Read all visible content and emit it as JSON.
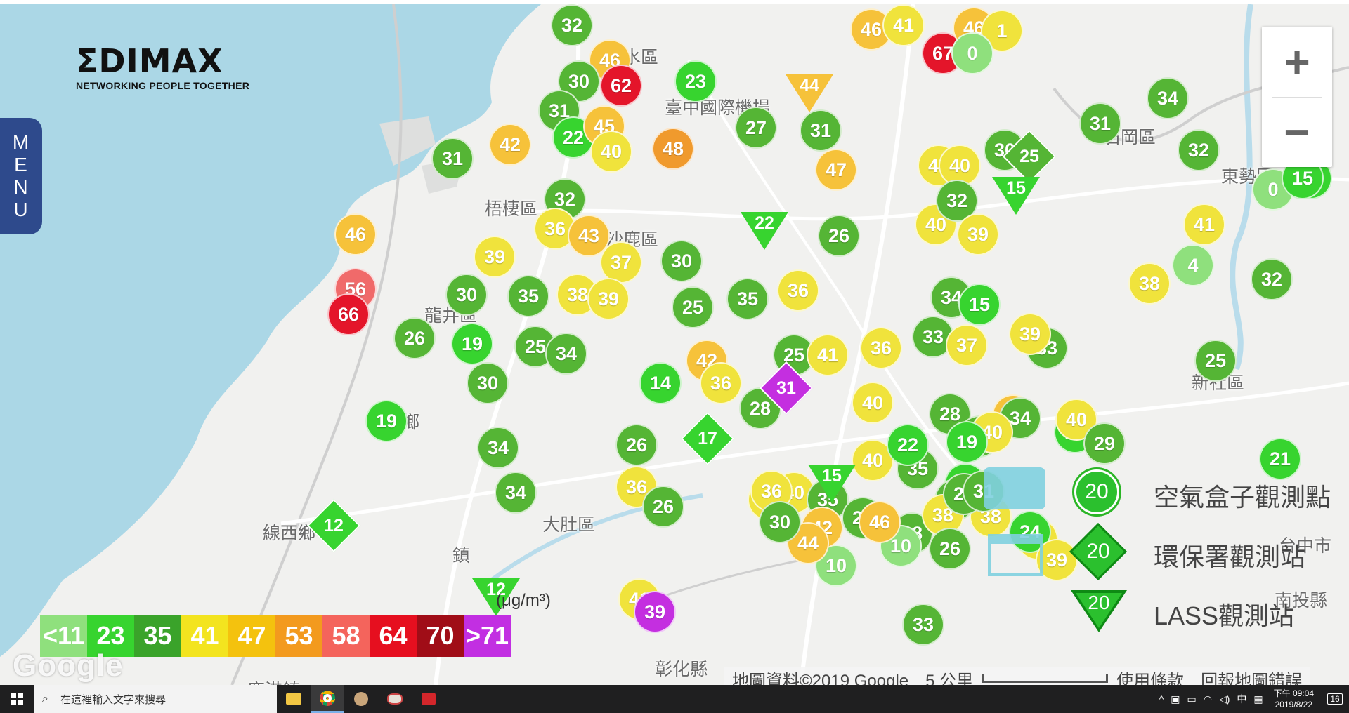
{
  "logo": {
    "brand": "ΣDIMAX",
    "tagline": "NETWORKING PEOPLE TOGETHER"
  },
  "menu": {
    "letters": [
      "M",
      "E",
      "N",
      "U"
    ]
  },
  "zoom": {
    "in_label": "+",
    "out_label": "−"
  },
  "places": [
    {
      "id": "qingshui",
      "label": "清水區"
    },
    {
      "id": "airport",
      "label": "臺中國際機場"
    },
    {
      "id": "wuqi",
      "label": "梧棲區"
    },
    {
      "id": "shalu",
      "label": "沙鹿區"
    },
    {
      "id": "longjing",
      "label": "龍井區"
    },
    {
      "id": "shengang",
      "label": "伸港鄉"
    },
    {
      "id": "xianxi",
      "label": "線西鄉"
    },
    {
      "id": "dadu",
      "label": "大肚區"
    },
    {
      "id": "shigang",
      "label": "石岡區"
    },
    {
      "id": "dongshi",
      "label": "東勢區"
    },
    {
      "id": "xinshe",
      "label": "新社區"
    },
    {
      "id": "taichung",
      "label": "台中市"
    },
    {
      "id": "nantou",
      "label": "南投縣"
    },
    {
      "id": "changhua",
      "label": "彰化縣"
    },
    {
      "id": "lugang",
      "label": "鹿港鎮"
    },
    {
      "id": "hemei",
      "label": "鎮"
    }
  ],
  "colors": {
    "c11": "#8fe07d",
    "c23": "#37d42f",
    "c35": "#55b535",
    "c41": "#f0e33c",
    "c47": "#f6c23a",
    "c53": "#f09a2d",
    "c58": "#f06a6a",
    "c64": "#e4152a",
    "c70": "#a0101e",
    "c71": "#c42fe0"
  },
  "legend": {
    "unit": "(μg/m³)",
    "scale": [
      {
        "label": "<11",
        "color": "#8fe07d"
      },
      {
        "label": "23",
        "color": "#37d42f"
      },
      {
        "label": "35",
        "color": "#3aa32a"
      },
      {
        "label": "41",
        "color": "#f3e41f"
      },
      {
        "label": "47",
        "color": "#f4c20e"
      },
      {
        "label": "53",
        "color": "#f39a1e"
      },
      {
        "label": "58",
        "color": "#f4645c"
      },
      {
        "label": "64",
        "color": "#e60f1f"
      },
      {
        "label": "70",
        "color": "#a00d17"
      },
      {
        "label": ">71",
        "color": "#c22fe2"
      }
    ],
    "types": [
      {
        "icon": "circle",
        "value": "20",
        "label": "空氣盒子觀測點"
      },
      {
        "icon": "diamond",
        "value": "20",
        "label": "環保署觀測站"
      },
      {
        "icon": "triangle",
        "value": "20",
        "label": "LASS觀測站"
      }
    ]
  },
  "attribution": {
    "google": "Google",
    "map_data": "地圖資料©2019 Google",
    "scale": "5 公里",
    "terms": "使用條款",
    "report": "回報地圖錯誤"
  },
  "markers": [
    {
      "v": "32",
      "c": "c35"
    },
    {
      "v": "46",
      "c": "c47"
    },
    {
      "v": "41",
      "c": "c41"
    },
    {
      "v": "67",
      "c": "c64"
    },
    {
      "v": "46",
      "c": "c47"
    },
    {
      "v": "1",
      "c": "c41"
    },
    {
      "v": "0",
      "c": "c11"
    },
    {
      "v": "46",
      "c": "c47"
    },
    {
      "v": "30",
      "c": "c35"
    },
    {
      "v": "62",
      "c": "c64"
    },
    {
      "v": "23",
      "c": "c23"
    },
    {
      "v": "34",
      "c": "c35"
    },
    {
      "v": "42",
      "c": "c47"
    },
    {
      "v": "31",
      "c": "c35"
    },
    {
      "v": "22",
      "c": "c23"
    },
    {
      "v": "45",
      "c": "c47"
    },
    {
      "v": "40",
      "c": "c41"
    },
    {
      "v": "48",
      "c": "c53"
    },
    {
      "v": "27",
      "c": "c35"
    },
    {
      "v": "31",
      "c": "c35"
    },
    {
      "v": "31",
      "c": "c35"
    },
    {
      "v": "32",
      "c": "c35"
    },
    {
      "v": "31",
      "c": "c35"
    },
    {
      "v": "47",
      "c": "c47"
    },
    {
      "v": "41",
      "c": "c41"
    },
    {
      "v": "40",
      "c": "c41"
    },
    {
      "v": "30",
      "c": "c35"
    },
    {
      "v": "15",
      "c": "c23"
    },
    {
      "v": "0",
      "c": "c11"
    },
    {
      "v": "32",
      "c": "c35"
    },
    {
      "v": "36",
      "c": "c41"
    },
    {
      "v": "43",
      "c": "c47"
    },
    {
      "v": "26",
      "c": "c35"
    },
    {
      "v": "40",
      "c": "c41"
    },
    {
      "v": "32",
      "c": "c35"
    },
    {
      "v": "39",
      "c": "c41"
    },
    {
      "v": "41",
      "c": "c41"
    },
    {
      "v": "46",
      "c": "c47"
    },
    {
      "v": "39",
      "c": "c41"
    },
    {
      "v": "15",
      "c": "c23"
    },
    {
      "v": "37",
      "c": "c41"
    },
    {
      "v": "30",
      "c": "c35"
    },
    {
      "v": "36",
      "c": "c41"
    },
    {
      "v": "4",
      "c": "c11"
    },
    {
      "v": "38",
      "c": "c41"
    },
    {
      "v": "32",
      "c": "c35"
    },
    {
      "v": "56",
      "c": "c58"
    },
    {
      "v": "66",
      "c": "c64"
    },
    {
      "v": "30",
      "c": "c35"
    },
    {
      "v": "35",
      "c": "c35"
    },
    {
      "v": "38",
      "c": "c41"
    },
    {
      "v": "39",
      "c": "c41"
    },
    {
      "v": "25",
      "c": "c35"
    },
    {
      "v": "35",
      "c": "c35"
    },
    {
      "v": "34",
      "c": "c35"
    },
    {
      "v": "15",
      "c": "c23"
    },
    {
      "v": "26",
      "c": "c35"
    },
    {
      "v": "19",
      "c": "c23"
    },
    {
      "v": "25",
      "c": "c35"
    },
    {
      "v": "34",
      "c": "c35"
    },
    {
      "v": "42",
      "c": "c47"
    },
    {
      "v": "25",
      "c": "c35"
    },
    {
      "v": "41",
      "c": "c41"
    },
    {
      "v": "36",
      "c": "c41"
    },
    {
      "v": "33",
      "c": "c35"
    },
    {
      "v": "37",
      "c": "c41"
    },
    {
      "v": "33",
      "c": "c35"
    },
    {
      "v": "39",
      "c": "c41"
    },
    {
      "v": "25",
      "c": "c35"
    },
    {
      "v": "30",
      "c": "c35"
    },
    {
      "v": "14",
      "c": "c23"
    },
    {
      "v": "36",
      "c": "c41"
    },
    {
      "v": "28",
      "c": "c35"
    },
    {
      "v": "40",
      "c": "c41"
    },
    {
      "v": "28",
      "c": "c35"
    },
    {
      "v": "43",
      "c": "c47"
    },
    {
      "v": "34",
      "c": "c35"
    },
    {
      "v": "12",
      "c": "c23"
    },
    {
      "v": "40",
      "c": "c41"
    },
    {
      "v": "19",
      "c": "c23"
    },
    {
      "v": "33",
      "c": "c35"
    },
    {
      "v": "40",
      "c": "c41"
    },
    {
      "v": "40",
      "c": "c41"
    },
    {
      "v": "35",
      "c": "c35"
    },
    {
      "v": "19",
      "c": "c23"
    },
    {
      "v": "23",
      "c": "c23"
    },
    {
      "v": "22",
      "c": "c23"
    },
    {
      "v": "29",
      "c": "c35"
    },
    {
      "v": "21",
      "c": "c23"
    },
    {
      "v": "34",
      "c": "c35"
    },
    {
      "v": "26",
      "c": "c35"
    },
    {
      "v": "36",
      "c": "c41"
    },
    {
      "v": "26",
      "c": "c35"
    },
    {
      "v": "36",
      "c": "c41"
    },
    {
      "v": "40",
      "c": "c41"
    },
    {
      "v": "35",
      "c": "c35"
    },
    {
      "v": "33",
      "c": "c35"
    },
    {
      "v": "38",
      "c": "c41"
    },
    {
      "v": "36",
      "c": "c41"
    },
    {
      "v": "25",
      "c": "c35"
    },
    {
      "v": "10",
      "c": "c11"
    },
    {
      "v": "28",
      "c": "c35"
    },
    {
      "v": "10",
      "c": "c11"
    },
    {
      "v": "41",
      "c": "c41"
    },
    {
      "v": "39",
      "c": "c71"
    },
    {
      "v": "33",
      "c": "c35"
    },
    {
      "v": "42",
      "c": "c47"
    },
    {
      "v": "38",
      "c": "c41"
    },
    {
      "v": "26",
      "c": "c35"
    },
    {
      "v": "39",
      "c": "c41"
    },
    {
      "v": "34",
      "c": "c35"
    },
    {
      "v": "46",
      "c": "c47"
    },
    {
      "v": "44",
      "c": "c47"
    },
    {
      "v": "30",
      "c": "c35"
    },
    {
      "v": "24",
      "c": "c23"
    },
    {
      "v": "28",
      "c": "c35"
    },
    {
      "v": "31",
      "c": "c35"
    },
    {
      "v": "39",
      "c": "c41"
    }
  ],
  "special_markers": [
    {
      "shape": "triangle",
      "v": "44",
      "c": "c47"
    },
    {
      "shape": "triangle",
      "v": "22",
      "c": "c23"
    },
    {
      "shape": "diamond",
      "v": "25",
      "c": "c35"
    },
    {
      "shape": "triangle",
      "v": "15",
      "c": "c23"
    },
    {
      "shape": "diamond",
      "v": "17",
      "c": "c23"
    },
    {
      "shape": "triangle",
      "v": "15",
      "c": "c23"
    },
    {
      "shape": "diamond",
      "v": "12",
      "c": "c23"
    },
    {
      "shape": "triangle",
      "v": "12",
      "c": "c23"
    },
    {
      "shape": "diamond",
      "v": "31",
      "c": "c71"
    }
  ],
  "taskbar": {
    "search_placeholder": "在這裡輸入文字來搜尋",
    "time": "下午 09:04",
    "date": "2019/8/22",
    "ime": "中",
    "notifications": "16"
  }
}
